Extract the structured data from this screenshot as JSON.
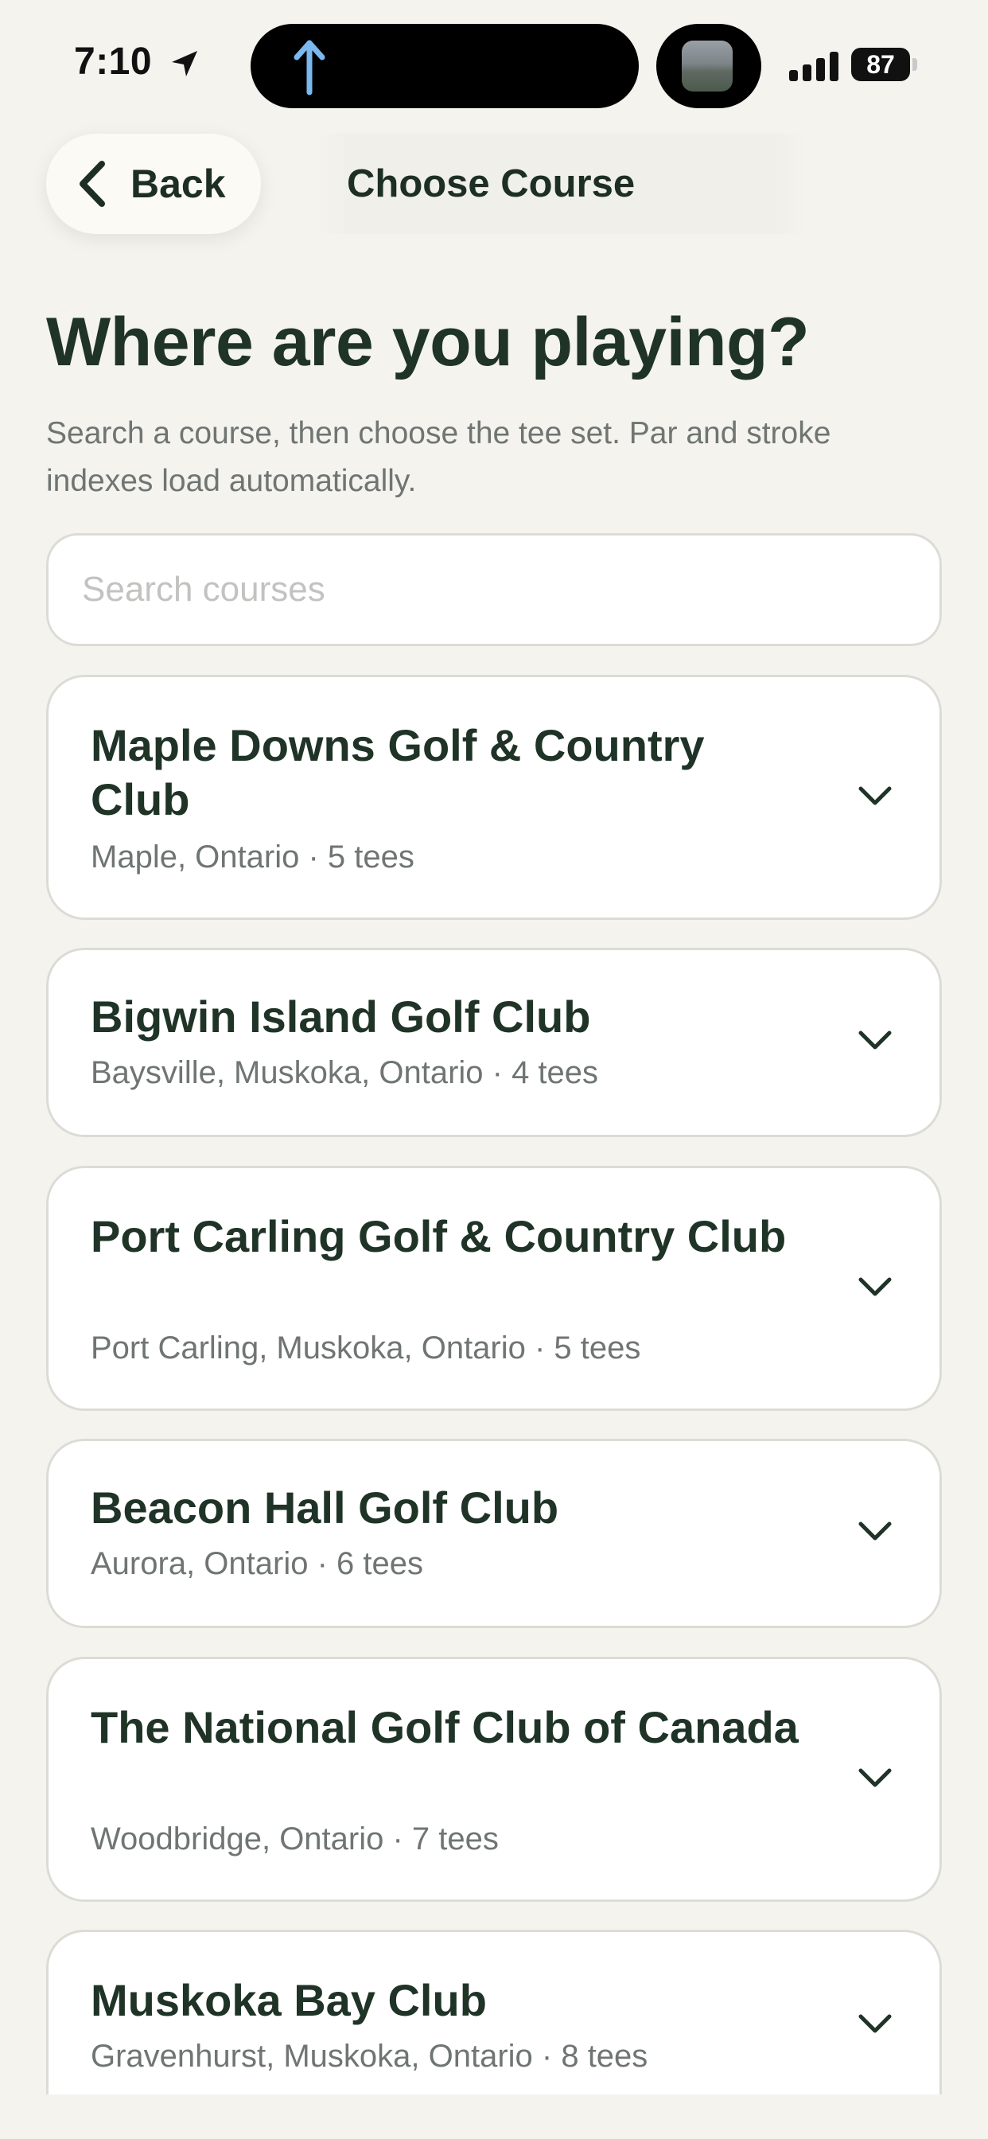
{
  "status_bar": {
    "time": "7:10",
    "battery": "87",
    "icons": [
      "location-arrow-icon",
      "upload-arrow-icon",
      "signal-icon",
      "battery-icon"
    ]
  },
  "nav": {
    "back_label": "Back",
    "title": "Choose Course"
  },
  "header": {
    "title": "Where are you playing?",
    "subtitle": "Search a course, then choose the tee set. Par and stroke indexes load automatically."
  },
  "search": {
    "placeholder": "Search courses",
    "value": ""
  },
  "courses": [
    {
      "name": "Maple Downs Golf & Country Club",
      "meta": "Maple, Ontario · 5 tees"
    },
    {
      "name": "Bigwin Island Golf Club",
      "meta": "Baysville, Muskoka, Ontario · 4 tees"
    },
    {
      "name": "Port Carling Golf & Country Club",
      "meta": "Port Carling, Muskoka, Ontario · 5 tees"
    },
    {
      "name": "Beacon Hall Golf Club",
      "meta": "Aurora, Ontario · 6 tees"
    },
    {
      "name": "The National Golf Club of Canada",
      "meta": "Woodbridge, Ontario · 7 tees"
    },
    {
      "name": "Muskoka Bay Club",
      "meta": "Gravenhurst, Muskoka, Ontario · 8 tees"
    }
  ],
  "colors": {
    "background": "#f4f3ee",
    "card": "#ffffff",
    "text_primary": "#1f3327",
    "text_secondary": "#6f7572",
    "border": "#dcdcd6",
    "accent_blue": "#7ab8ee"
  }
}
